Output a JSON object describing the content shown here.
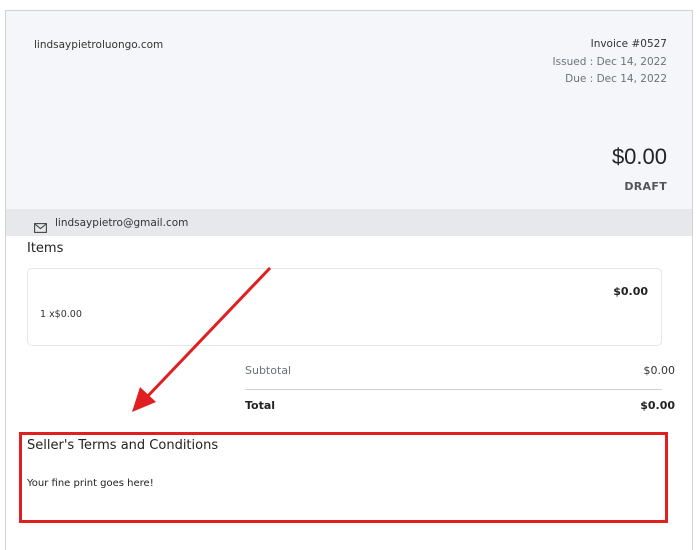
{
  "invoice": {
    "domain": "lindsaypietroluongo.com",
    "number": "Invoice #0527",
    "issued": "Issued : Dec 14, 2022",
    "due": "Due : Dec 14, 2022",
    "amount": "$0.00",
    "status": "DRAFT",
    "email": "lindsaypietro@gmail.com"
  },
  "items": {
    "title": "Items",
    "list": [
      {
        "price": "$0.00",
        "description": "1 x$0.00"
      }
    ]
  },
  "totals": {
    "subtotal_label": "Subtotal",
    "subtotal_value": "$0.00",
    "total_label": "Total",
    "total_value": "$0.00"
  },
  "terms": {
    "title": "Seller's Terms and Conditions",
    "text": "Your fine print goes here!"
  },
  "annotation": {
    "color": "#e02020",
    "icon": "email-icon"
  }
}
